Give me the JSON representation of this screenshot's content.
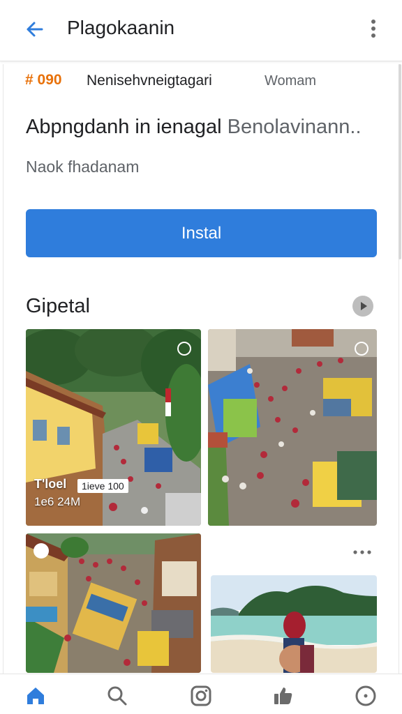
{
  "app_bar": {
    "title": "Plagokaanin",
    "back_icon": "arrow-left-icon",
    "menu_icon": "more-vert-icon"
  },
  "listing": {
    "rating": "# 090",
    "name": "Nenisehvneigtagari",
    "right_label": "Womam",
    "headline": "Abpngdanh in ienagal",
    "headline_secondary": "Benolavinann..",
    "subtitle": "Naok fhadanam",
    "install_label": "Instal"
  },
  "gallery": {
    "title": "Gipetal",
    "tiles": [
      {
        "overlay_title": "T'loel",
        "overlay_chip": "1ieve 100",
        "overlay_time": "1e6 24M"
      }
    ]
  },
  "colors": {
    "accent": "#2f7ddc",
    "rating": "#e8710a",
    "nav_active": "#2f7ddc",
    "nav_inactive": "#6b6b6b"
  },
  "bottom_nav": [
    {
      "icon": "home-icon",
      "active": true
    },
    {
      "icon": "search-icon",
      "active": false
    },
    {
      "icon": "instagram-icon",
      "active": false
    },
    {
      "icon": "thumbs-up-icon",
      "active": false
    },
    {
      "icon": "account-circle-icon",
      "active": false
    }
  ]
}
